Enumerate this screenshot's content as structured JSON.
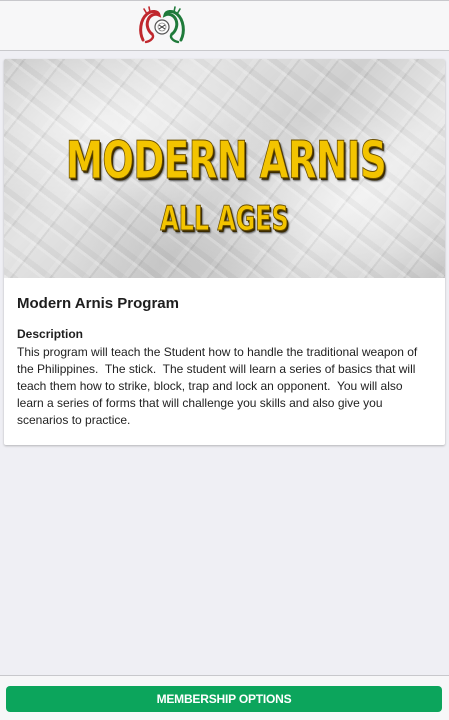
{
  "colors": {
    "accent_button": "#0ca55c",
    "background": "#efeff4",
    "banner_text": "#f3c400",
    "logo_red": "#c0272d",
    "logo_green": "#1f7a3a"
  },
  "header": {
    "logo_icon": "dragon-emblem-logo"
  },
  "banner": {
    "title": "MODERN ARNIS",
    "subtitle": "ALL AGES"
  },
  "program": {
    "title": "Modern Arnis Program",
    "description_label": "Description",
    "description": "This program will teach the Student how to handle the traditional weapon of the Philippines.  The stick.  The student will learn a series of basics that will teach them how to strike, block, trap and lock an opponent.  You will also learn a series of forms that will challenge you skills and also give you scenarios to practice."
  },
  "footer": {
    "button_label": "MEMBERSHIP OPTIONS"
  }
}
